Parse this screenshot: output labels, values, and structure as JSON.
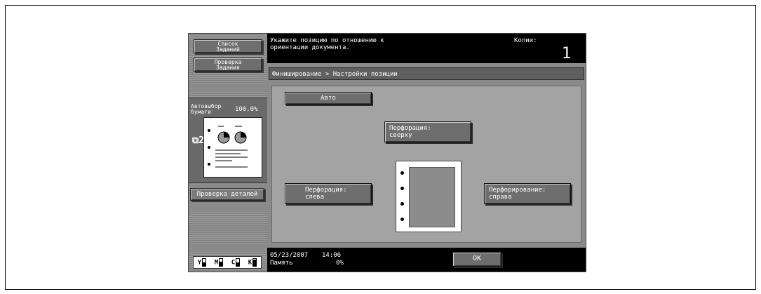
{
  "left_panel": {
    "job_list_button": "Список\nЗаданий",
    "check_job_button": "Проверка\nЗадания",
    "paper_label": "Автовыбор\nбумаги",
    "zoom": "100.0%",
    "two_up_glyph": "⧉2",
    "check_details_button": "Проверка деталей",
    "toner": [
      {
        "label": "Y",
        "level": 0.5
      },
      {
        "label": "M",
        "level": 0.6
      },
      {
        "label": "C",
        "level": 0.5
      },
      {
        "label": "K",
        "level": 0.95
      }
    ]
  },
  "message_bar": {
    "message": "Укажите позицию по отношению к\nориентации документа.",
    "copies_label": "Копии:",
    "copies_value": "1"
  },
  "breadcrumb": "Финиширование > Настройки позиции",
  "buttons": {
    "auto": "Авто",
    "top": "Перфорация:\nсверху",
    "left": "Перфорация:\nслева",
    "right": "Перфорирование:\nсправа",
    "ok": "OK"
  },
  "status": {
    "date": "05/23/2007",
    "time": "14:06",
    "memory_label": "Память",
    "memory_value": "0%"
  }
}
